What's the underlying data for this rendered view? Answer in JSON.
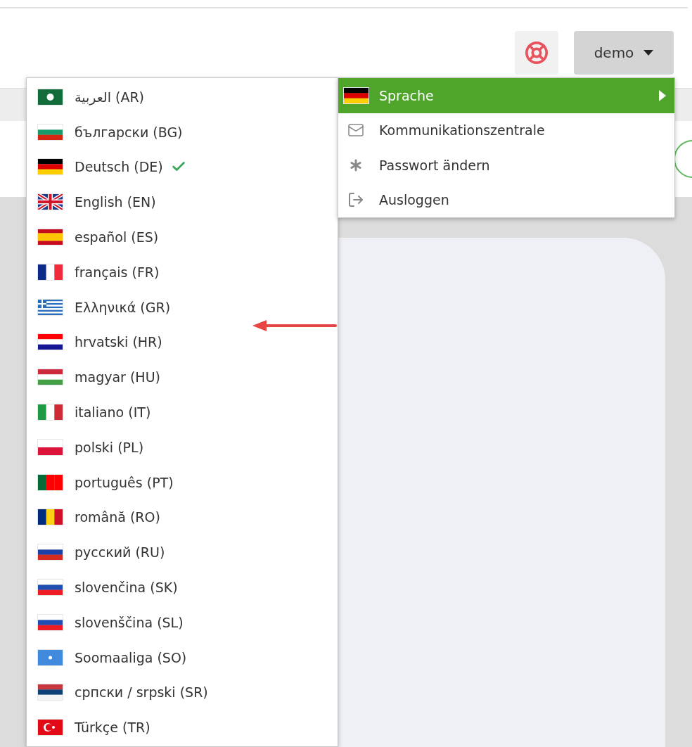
{
  "header": {
    "user_button": "demo"
  },
  "user_menu": [
    {
      "label": "Sprache",
      "kind": "submenu",
      "selected": true
    },
    {
      "label": "Kommunikationszentrale",
      "kind": "mail",
      "selected": false
    },
    {
      "label": "Passwort ändern",
      "kind": "password",
      "selected": false
    },
    {
      "label": "Ausloggen",
      "kind": "logout",
      "selected": false
    }
  ],
  "languages": [
    {
      "label": "العربية (AR)",
      "selected": false,
      "kind": "arabic"
    },
    {
      "label": "български (BG)",
      "selected": false,
      "kind": "bulgarian"
    },
    {
      "label": "Deutsch (DE)",
      "selected": true,
      "kind": "german"
    },
    {
      "label": "English (EN)",
      "selected": false,
      "kind": "english"
    },
    {
      "label": "español (ES)",
      "selected": false,
      "kind": "spanish"
    },
    {
      "label": "français (FR)",
      "selected": false,
      "kind": "french"
    },
    {
      "label": "Ελληνικά (GR)",
      "selected": false,
      "kind": "greek"
    },
    {
      "label": "hrvatski (HR)",
      "selected": false,
      "kind": "croatian"
    },
    {
      "label": "magyar (HU)",
      "selected": false,
      "kind": "hungarian"
    },
    {
      "label": "italiano (IT)",
      "selected": false,
      "kind": "italian"
    },
    {
      "label": "polski (PL)",
      "selected": false,
      "kind": "polish"
    },
    {
      "label": "português (PT)",
      "selected": false,
      "kind": "portuguese"
    },
    {
      "label": "română (RO)",
      "selected": false,
      "kind": "romanian"
    },
    {
      "label": "русский (RU)",
      "selected": false,
      "kind": "russian"
    },
    {
      "label": "slovenčina (SK)",
      "selected": false,
      "kind": "slovak"
    },
    {
      "label": "slovenščina (SL)",
      "selected": false,
      "kind": "slovenian"
    },
    {
      "label": "Soomaaliga (SO)",
      "selected": false,
      "kind": "somali"
    },
    {
      "label": "српски / srpski (SR)",
      "selected": false,
      "kind": "serbian"
    },
    {
      "label": "Türkçe (TR)",
      "selected": false,
      "kind": "turkish"
    }
  ]
}
